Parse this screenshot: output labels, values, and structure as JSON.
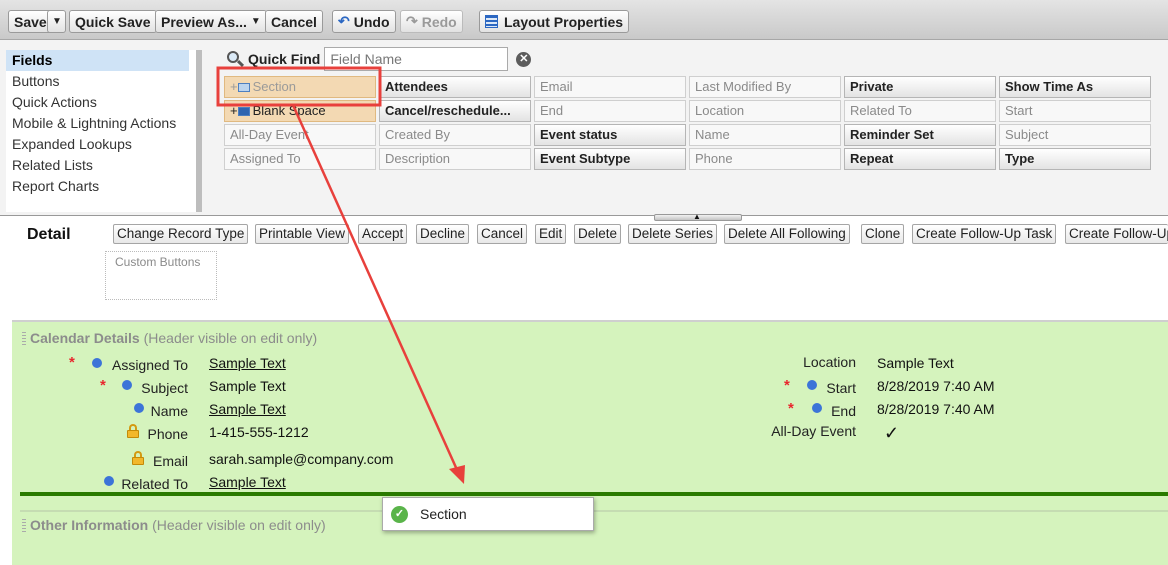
{
  "toolbar": {
    "save": "Save",
    "quick_save": "Quick Save",
    "preview_as": "Preview As...",
    "cancel": "Cancel",
    "undo": "Undo",
    "redo": "Redo",
    "layout_properties": "Layout Properties"
  },
  "palette": {
    "categories": [
      "Fields",
      "Buttons",
      "Quick Actions",
      "Mobile & Lightning Actions",
      "Expanded Lookups",
      "Related Lists",
      "Report Charts"
    ],
    "selected_category": "Fields",
    "quick_find_label": "Quick Find",
    "quick_find_placeholder": "Field Name",
    "fields": [
      [
        "Section",
        "Attendees",
        "Email",
        "Last Modified By",
        "Private",
        "Show Time As"
      ],
      [
        "Blank Space",
        "Cancel/reschedule...",
        "End",
        "Location",
        "Related To",
        "Start"
      ],
      [
        "All-Day Event",
        "Created By",
        "Event status",
        "Name",
        "Reminder Set",
        "Subject"
      ],
      [
        "Assigned To",
        "Description",
        "Event Subtype",
        "Phone",
        "Repeat",
        "Type"
      ]
    ]
  },
  "detail": {
    "label": "Detail",
    "buttons": [
      "Change Record Type",
      "Printable View",
      "Accept",
      "Decline",
      "Cancel",
      "Edit",
      "Delete",
      "Delete Series",
      "Delete All Following",
      "Clone",
      "Create Follow-Up Task",
      "Create Follow-Up"
    ],
    "custom_buttons": "Custom Buttons"
  },
  "calendar_section": {
    "title": "Calendar Details",
    "note": "(Header visible on edit only)",
    "left_fields": [
      {
        "label": "Assigned To",
        "value": "Sample Text"
      },
      {
        "label": "Subject",
        "value": "Sample Text"
      },
      {
        "label": "Name",
        "value": "Sample Text"
      },
      {
        "label": "Phone",
        "value": "1-415-555-1212"
      },
      {
        "label": "Email",
        "value": "sarah.sample@company.com"
      },
      {
        "label": "Related To",
        "value": "Sample Text"
      }
    ],
    "right_fields": [
      {
        "label": "Location",
        "value": "Sample Text"
      },
      {
        "label": "Start",
        "value": "8/28/2019 7:40 AM"
      },
      {
        "label": "End",
        "value": "8/28/2019 7:40 AM"
      },
      {
        "label": "All-Day Event",
        "value": "✓"
      }
    ]
  },
  "other_section": {
    "title": "Other Information",
    "note": "(Header visible on edit only)"
  },
  "drag_tooltip": "Section",
  "colors": {
    "section_bg": "#d5f3bd",
    "drop_line": "#2a7a00",
    "annotation_red": "#e8403c",
    "required": "#e8262d",
    "indicator_blue": "#3c74d8"
  }
}
